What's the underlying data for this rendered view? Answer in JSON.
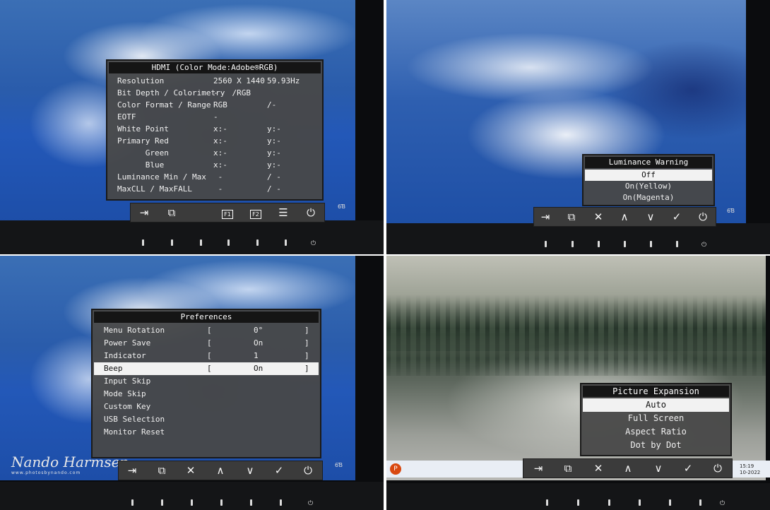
{
  "panels": {
    "hdmi_info": {
      "title": "HDMI (Color Mode:Adobe®RGB)",
      "rows": [
        {
          "label": "Resolution",
          "v1": "2560 X 1440",
          "v2": "59.93Hz"
        },
        {
          "label": "Bit Depth / Colorimetry",
          "v1": "-   /RGB",
          "v2": ""
        },
        {
          "label": "Color Format / Range",
          "v1": "RGB",
          "v2": "/-"
        },
        {
          "label": "EOTF",
          "v1": "-",
          "v2": ""
        },
        {
          "label": "White Point",
          "v1": "x:-",
          "v2": "y:-"
        },
        {
          "label": "Primary Red",
          "v1": "x:-",
          "v2": "y:-"
        },
        {
          "label": "      Green",
          "v1": "x:-",
          "v2": "y:-"
        },
        {
          "label": "      Blue",
          "v1": "x:-",
          "v2": "y:-"
        },
        {
          "label": "Luminance Min / Max",
          "v1": " -",
          "v2": "/ -"
        },
        {
          "label": "MaxCLL / MaxFALL",
          "v1": " -",
          "v2": "/ -"
        }
      ],
      "bar_buttons": [
        "⇥",
        "⧉",
        "F1",
        "F2",
        "☰",
        "⏻"
      ]
    },
    "luminance_warning": {
      "title": "Luminance Warning",
      "options": [
        "Off",
        "On(Yellow)",
        "On(Magenta)"
      ],
      "selected_index": 0,
      "bar_buttons": [
        "⇥",
        "⧉",
        "✕",
        "∧",
        "∨",
        "✓",
        "⏻"
      ]
    },
    "preferences": {
      "title": "Preferences",
      "rows": [
        {
          "label": "Menu Rotation",
          "value": "0°"
        },
        {
          "label": "Power Save",
          "value": "On"
        },
        {
          "label": "Indicator",
          "value": "1"
        },
        {
          "label": "Beep",
          "value": "On"
        },
        {
          "label": "Input Skip",
          "value": ""
        },
        {
          "label": "Mode Skip",
          "value": ""
        },
        {
          "label": "Custom Key",
          "value": ""
        },
        {
          "label": "USB Selection",
          "value": ""
        },
        {
          "label": "Monitor Reset",
          "value": ""
        }
      ],
      "selected_index": 3,
      "bar_buttons": [
        "⇥",
        "⧉",
        "✕",
        "∧",
        "∨",
        "✓",
        "⏻"
      ],
      "signature": "Nando Harmsen",
      "signature_url": "www.photosbynando.com"
    },
    "picture_expansion": {
      "title": "Picture Expansion",
      "options": [
        "Auto",
        "Full Screen",
        "Aspect Ratio",
        "Dot by Dot"
      ],
      "selected_index": 0,
      "bar_buttons": [
        "⇥",
        "⧉",
        "✕",
        "∧",
        "∨",
        "✓",
        "⏻"
      ],
      "tray_time": "15:19",
      "tray_date": "10-2022"
    }
  },
  "bezel": {
    "power_symbol": "⏻",
    "logo": "6Ɓ"
  },
  "colors": {
    "osd_bg": "#484848",
    "osd_title": "#151515",
    "selected_row": "#f2f2f2",
    "accent_power": "#d9480f"
  }
}
